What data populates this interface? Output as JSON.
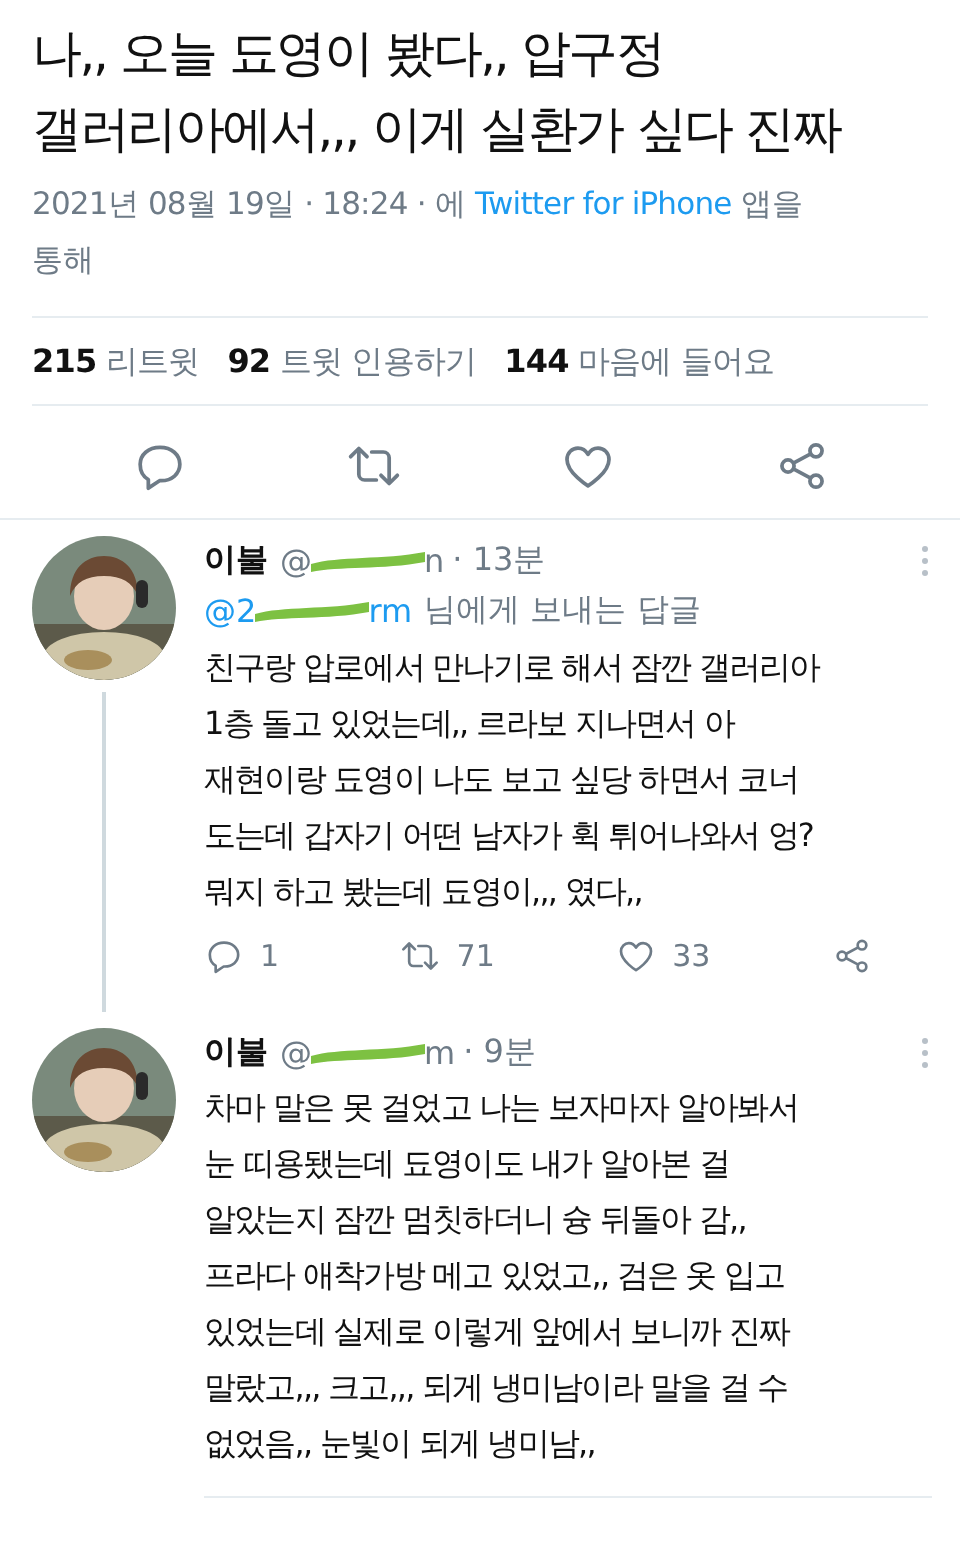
{
  "tweet": {
    "text": "나,, 오늘 됴영이 봤다,, 압구정\n갤러리아에서,,, 이게 실환가 싶다 진짜",
    "date": "2021년 08월 19일 · 18:24 · 에",
    "source": "Twitter for iPhone",
    "source_suffix": "앱을\n통해",
    "stats": [
      {
        "count": "215",
        "label": "리트윗"
      },
      {
        "count": "92",
        "label": "트윗 인용하기"
      },
      {
        "count": "144",
        "label": "마음에 들어요"
      }
    ],
    "actions": [
      {
        "kind": "reply"
      },
      {
        "kind": "retweet"
      },
      {
        "kind": "like"
      },
      {
        "kind": "share"
      }
    ]
  },
  "replies": [
    {
      "name": "이불",
      "handle_start": "@",
      "handle_end": "n",
      "time": "· 13분",
      "reply_to_start": "@2",
      "reply_to_end": "rm",
      "reply_to_label": "님에게 보내는 답글",
      "text": "친구랑 압로에서 만나기로 해서 잠깐 갤러리아\n1층 돌고 있었는데,, 르라보 지나면서 아\n재현이랑 됴영이 나도 보고 싶당 하면서 코너\n도는데 갑자기 어떤 남자가 휙 튀어나와서 엉?\n뭐지 하고 봤는데 됴영이,,, 였다,,",
      "thread": true,
      "actions": [
        {
          "kind": "reply",
          "count": "1"
        },
        {
          "kind": "retweet",
          "count": "71"
        },
        {
          "kind": "like",
          "count": "33"
        },
        {
          "kind": "share"
        }
      ]
    },
    {
      "name": "이불",
      "handle_start": "@",
      "handle_end": "m",
      "time": "· 9분",
      "text": "차마 말은 못 걸었고 나는 보자마자 알아봐서\n눈 띠용됐는데 됴영이도 내가 알아본 걸\n알았는지 잠깐 멈칫하더니 슝 뒤돌아 감,,\n프라다 애착가방 메고 있었고,, 검은 옷 입고\n있었는데 실제로 이렇게 앞에서 보니까 진짜\n말랐고,,, 크고,,, 되게 냉미남이라 말을 걸 수\n없었음,, 눈빛이 되게 냉미남,,",
      "thread": false
    }
  ]
}
